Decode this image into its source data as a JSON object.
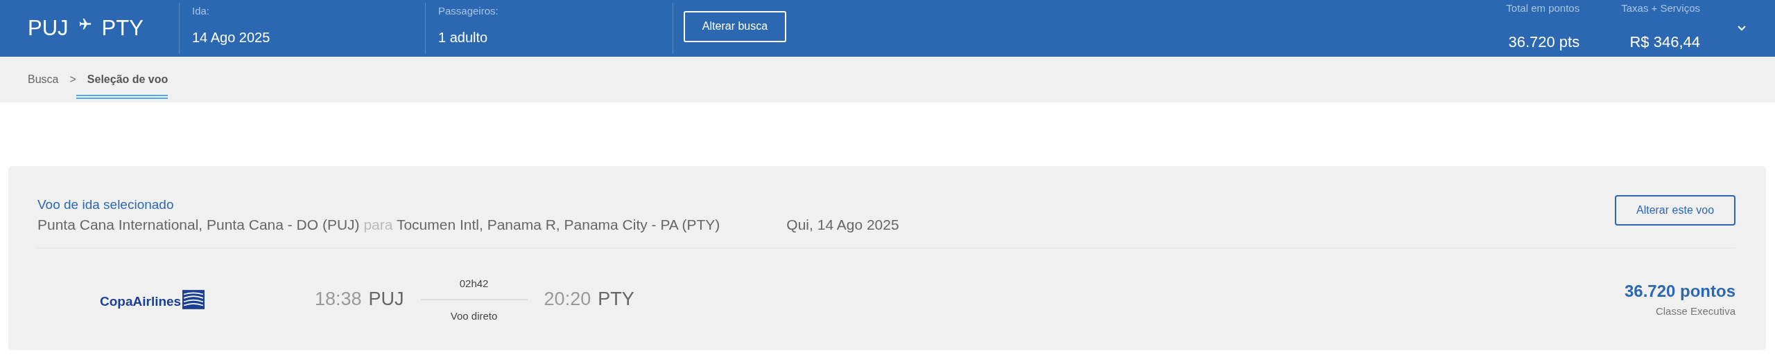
{
  "header": {
    "origin": "PUJ",
    "destination": "PTY",
    "fields": [
      {
        "label": "Ida:",
        "value": "14 Ago 2025"
      },
      {
        "label": "Passageiros:",
        "value": "1 adulto"
      }
    ],
    "search_button": "Alterar busca",
    "totals": [
      {
        "label": "Total em pontos",
        "value": "36.720 pts"
      },
      {
        "label": "Taxas + Serviços",
        "value": "R$ 346,44"
      }
    ]
  },
  "breadcrumb": [
    {
      "label": "Busca",
      "selected": false
    },
    {
      "separator": ">"
    },
    {
      "label": "Seleção de voo",
      "selected": true
    }
  ],
  "selected_flight": {
    "title": "Voo de ida selecionado",
    "origin": "Punta Cana International, Punta Cana - DO (PUJ)",
    "connector": "para",
    "destination": "Tocumen Intl, Panama R, Panama City - PA (PTY)",
    "date": "Qui, 14 Ago 2025",
    "change_button": "Alterar este voo",
    "airline": "CopaAirlines",
    "departure_time": "18:38",
    "departure_code": "PUJ",
    "duration": "02h42",
    "stops": "Voo direto",
    "arrival_time": "20:20",
    "arrival_code": "PTY",
    "price": "36.720 pontos",
    "cabin": "Classe Executiva"
  }
}
